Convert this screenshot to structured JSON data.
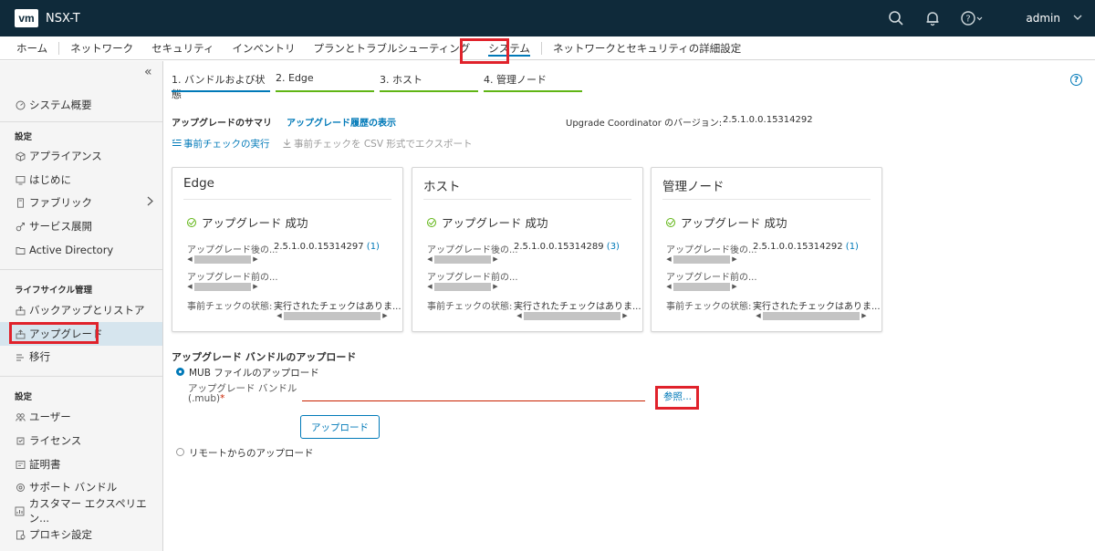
{
  "header": {
    "logo": "vm",
    "title": "NSX-T",
    "user": "admin"
  },
  "nav": {
    "items": [
      "ホーム",
      "ネットワーク",
      "セキュリティ",
      "インベントリ",
      "プランとトラブルシューティング",
      "システム",
      "ネットワークとセキュリティの詳細設定"
    ],
    "active": "システム"
  },
  "sidebar": {
    "collapse": "«",
    "overview": "システム概要",
    "section_settings": "設定",
    "appliances": "アプライアンス",
    "getting_started": "はじめに",
    "fabric": "ファブリック",
    "service_deploy": "サービス展開",
    "active_directory": "Active Directory",
    "section_lifecycle": "ライフサイクル管理",
    "backup": "バックアップとリストア",
    "upgrade": "アップグレード",
    "migrate": "移行",
    "section_settings2": "設定",
    "users": "ユーザー",
    "licenses": "ライセンス",
    "certificates": "証明書",
    "support_bundle": "サポート バンドル",
    "customer_exp": "カスタマー エクスペリエン...",
    "proxy": "プロキシ設定"
  },
  "steps": [
    {
      "label": "1. バンドルおよび状態",
      "color": "#0079b8"
    },
    {
      "label": "2. Edge",
      "color": "#60b515"
    },
    {
      "label": "3. ホスト",
      "color": "#60b515"
    },
    {
      "label": "4. 管理ノード",
      "color": "#60b515"
    }
  ],
  "help": "?",
  "summary": {
    "title": "アップグレードのサマリ",
    "history_link": "アップグレード履歴の表示",
    "version_label": "Upgrade Coordinator のバージョン:",
    "version": "2.5.1.0.0.15314292"
  },
  "actions": {
    "precheck": "事前チェックの実行",
    "export": "事前チェックを CSV 形式でエクスポート"
  },
  "cards": [
    {
      "title": "Edge",
      "status": "アップグレード 成功",
      "after_label": "アップグレード後の...",
      "after_value": "2.5.1.0.0.15314297",
      "after_count": "(1)",
      "before_label": "アップグレード前の...",
      "precheck_label": "事前チェックの状態:",
      "precheck_value": "実行されたチェックはありま..."
    },
    {
      "title": "ホスト",
      "status": "アップグレード 成功",
      "after_label": "アップグレード後の...",
      "after_value": "2.5.1.0.0.15314289",
      "after_count": "(3)",
      "before_label": "アップグレード前の...",
      "precheck_label": "事前チェックの状態:",
      "precheck_value": "実行されたチェックはありま..."
    },
    {
      "title": "管理ノード",
      "status": "アップグレード 成功",
      "after_label": "アップグレード後の...",
      "after_value": "2.5.1.0.0.15314292",
      "after_count": "(1)",
      "before_label": "アップグレード前の...",
      "precheck_label": "事前チェックの状態:",
      "precheck_value": "実行されたチェックはありま..."
    }
  ],
  "upload": {
    "title": "アップグレード バンドルのアップロード",
    "mub_option": "MUB ファイルのアップロード",
    "field_label_1": "アップグレード バンドル",
    "field_label_2": "(.mub)",
    "required": "*",
    "browse": "参照...",
    "upload_button": "アップロード",
    "remote_option": "リモートからのアップロード"
  },
  "colors": {
    "topbar": "#0f2a3a",
    "accent": "#0079b8",
    "success": "#60b515",
    "highlight": "#e0222b"
  }
}
